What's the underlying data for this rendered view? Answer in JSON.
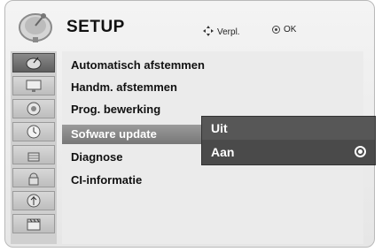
{
  "header": {
    "title": "SETUP",
    "move_hint": "Verpl.",
    "ok_hint": "OK",
    "icon": "satellite-dish-icon"
  },
  "sidebar": {
    "items": [
      {
        "icon": "satellite-dish-icon",
        "active": true
      },
      {
        "icon": "monitor-icon",
        "active": false
      },
      {
        "icon": "speaker-icon",
        "active": false
      },
      {
        "icon": "clock-icon",
        "active": false
      },
      {
        "icon": "lock-icon",
        "active": false
      },
      {
        "icon": "keyhole-icon",
        "active": false
      },
      {
        "icon": "usb-icon",
        "active": false
      },
      {
        "icon": "film-clapper-icon",
        "active": false
      }
    ]
  },
  "menu": {
    "items": [
      "Automatisch afstemmen",
      "Handm. afstemmen",
      "Prog. bewerking",
      "Sofware update",
      "Diagnose",
      "CI-informatie"
    ],
    "selected_index": 3
  },
  "submenu": {
    "options": [
      "Uit",
      "Aan"
    ],
    "selected_option": "Aan"
  },
  "colors": {
    "panel_bg": "#ebebeb",
    "selected_bg": "#8a8a8a",
    "submenu_bg": "#4b4b4b"
  }
}
